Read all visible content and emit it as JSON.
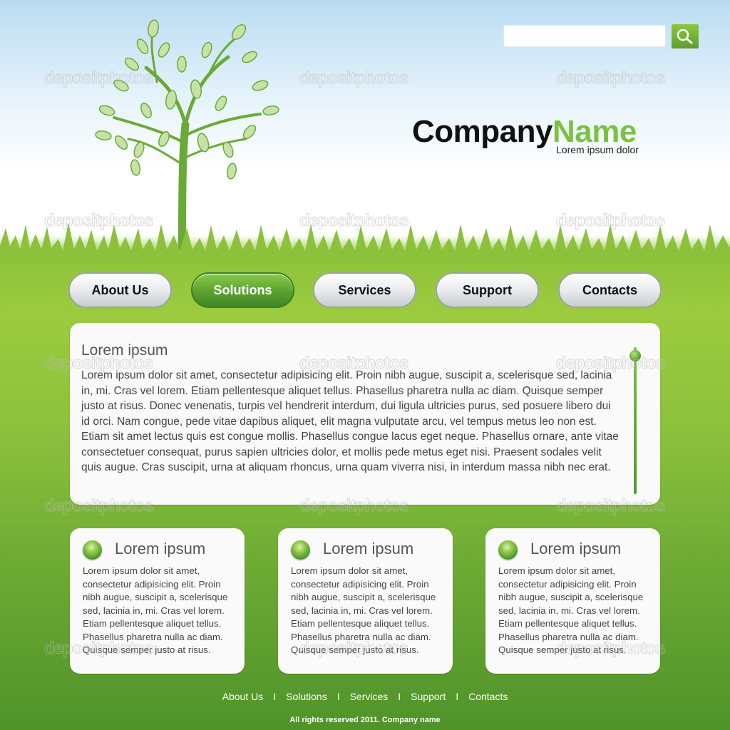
{
  "search": {
    "value": "",
    "placeholder": ""
  },
  "brand": {
    "company": "Company",
    "name": "Name",
    "tagline": "Lorem ipsum dolor"
  },
  "nav": [
    {
      "label": "About Us",
      "active": false
    },
    {
      "label": "Solutions",
      "active": true
    },
    {
      "label": "Services",
      "active": false
    },
    {
      "label": "Support",
      "active": false
    },
    {
      "label": "Contacts",
      "active": false
    }
  ],
  "main": {
    "title": "Lorem ipsum",
    "body": "Lorem ipsum dolor sit amet, consectetur adipisicing elit. Proin nibh augue, suscipit a, scelerisque sed, lacinia in, mi. Cras vel lorem. Etiam pellentesque aliquet tellus. Phasellus pharetra nulla ac diam. Quisque semper justo at risus. Donec venenatis, turpis vel hendrerit interdum, dui ligula ultricies purus, sed posuere libero dui id orci. Nam congue, pede vitae dapibus aliquet, elit magna vulputate arcu, vel tempus metus leo non est. Etiam sit amet lectus quis est congue mollis. Phasellus congue lacus eget neque. Phasellus ornare, ante vitae consectetuer consequat, purus sapien ultricies dolor, et mollis pede metus eget nisi. Praesent sodales velit quis augue. Cras suscipit, urna at aliquam rhoncus, urna quam viverra nisi, in interdum massa nibh nec erat."
  },
  "cards": [
    {
      "title": "Lorem ipsum",
      "body": "Lorem ipsum dolor sit amet, consectetur adipisicing elit. Proin nibh augue, suscipit a, scelerisque sed, lacinia in, mi. Cras vel lorem. Etiam pellentesque aliquet tellus. Phasellus pharetra nulla ac diam. Quisque semper justo at risus."
    },
    {
      "title": "Lorem ipsum",
      "body": "Lorem ipsum dolor sit amet, consectetur adipisicing elit. Proin nibh augue, suscipit a, scelerisque sed, lacinia in, mi. Cras vel lorem. Etiam pellentesque aliquet tellus. Phasellus pharetra nulla ac diam. Quisque semper justo at risus."
    },
    {
      "title": "Lorem ipsum",
      "body": "Lorem ipsum dolor sit amet, consectetur adipisicing elit. Proin nibh augue, suscipit a, scelerisque sed, lacinia in, mi. Cras vel lorem. Etiam pellentesque aliquet tellus. Phasellus pharetra nulla ac diam. Quisque semper justo at risus."
    }
  ],
  "footer": {
    "links": [
      "About Us",
      "Solutions",
      "Services",
      "Support",
      "Contacts"
    ],
    "separator": "I",
    "copyright": "All rights reserved 2011. Company name"
  },
  "watermark": "depositphotos",
  "icons": {
    "search": "search-icon",
    "tree": "tree-icon",
    "bullet": "bullet-icon"
  },
  "colors": {
    "accent": "#7cc242",
    "grass": "#8cc13c",
    "text": "#444444"
  }
}
